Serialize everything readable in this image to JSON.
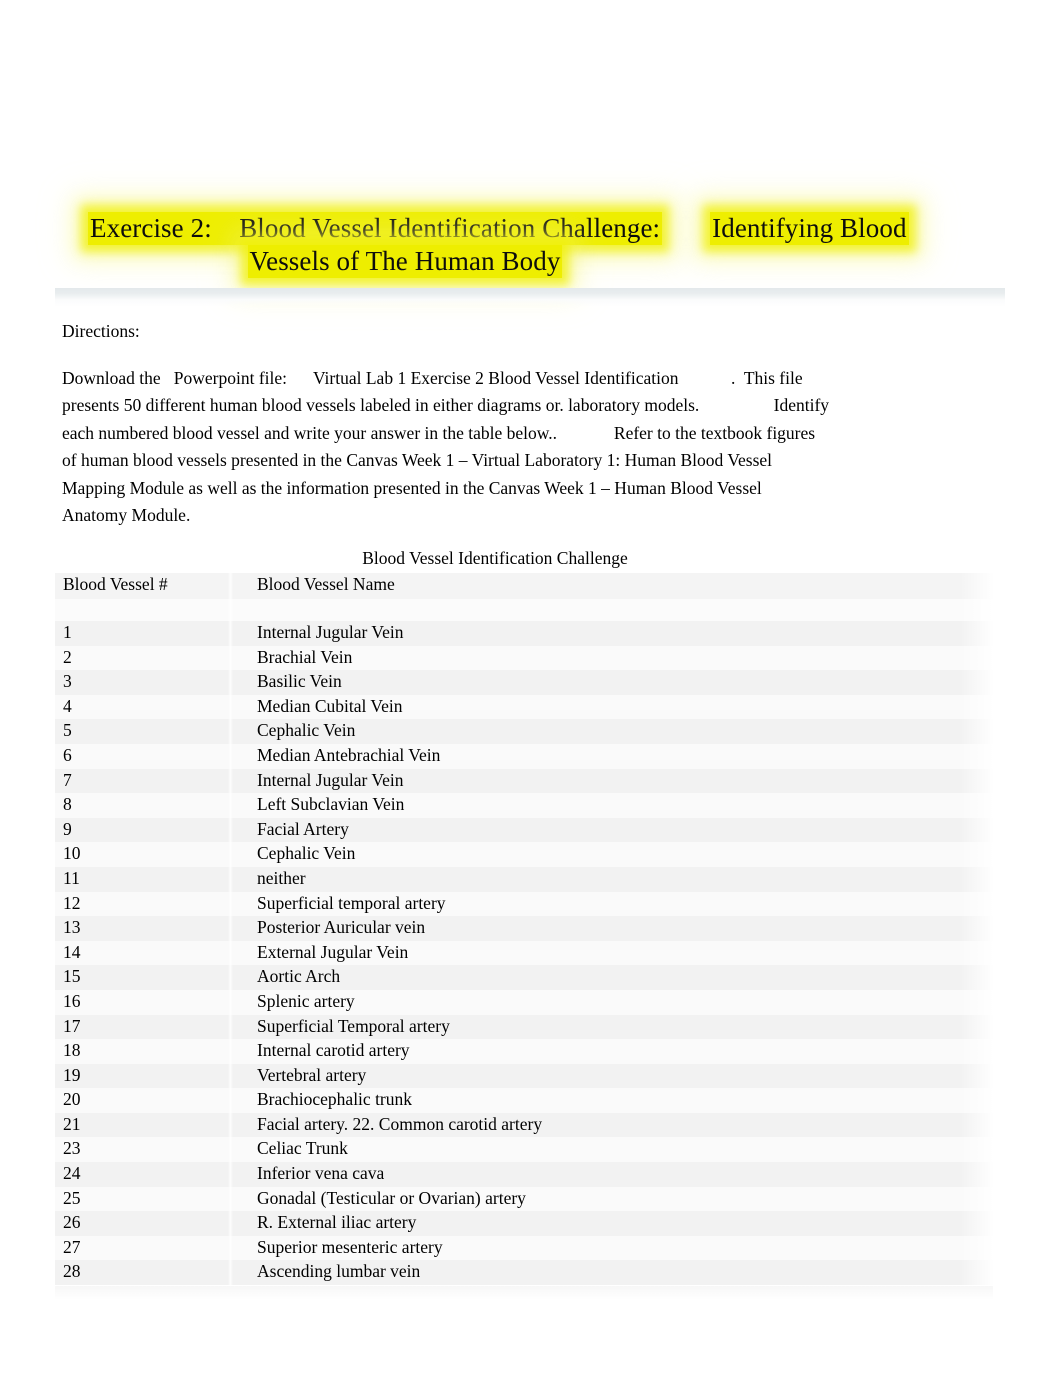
{
  "document": {
    "title_line_1": "Exercise 2:    Blood Vessel Identification Challenge:       Identifying Blood",
    "title_line_1_highlight_a": "Exercise 2:    Blood Vessel Identification Challenge:",
    "title_line_1_highlight_b": "Identifying Blood",
    "title_line_2": "Vessels of The Human Body",
    "highlight_color": "#eeee00",
    "rule_color": "#e8ecee",
    "text_color": "#000000"
  },
  "directions": {
    "label": "Directions:",
    "lines": [
      "Download the   Powerpoint file:      Virtual Lab 1 Exercise 2 Blood Vessel Identification            .  This file",
      "presents 50 different human blood vessels labeled in either diagrams or. laboratory models.                 Identify",
      "each numbered blood vessel and write your answer in the table below..             Refer to the textbook figures",
      "of human blood vessels presented in the Canvas Week 1 – Virtual Laboratory 1: Human Blood Vessel",
      "Mapping Module as well as the information presented in the Canvas Week 1 – Human Blood Vessel",
      "Anatomy Module."
    ]
  },
  "table": {
    "caption": "Blood Vessel Identification Challenge",
    "columns": [
      "Blood Vessel #",
      "Blood Vessel Name"
    ],
    "rows": [
      {
        "number": "1",
        "name": "Internal Jugular Vein"
      },
      {
        "number": "2",
        "name": "Brachial Vein"
      },
      {
        "number": "3",
        "name": "Basilic Vein"
      },
      {
        "number": "4",
        "name": "Median Cubital Vein"
      },
      {
        "number": "5",
        "name": "Cephalic Vein"
      },
      {
        "number": "6",
        "name": "Median Antebrachial Vein"
      },
      {
        "number": "7",
        "name": "Internal Jugular Vein"
      },
      {
        "number": "8",
        "name": "Left Subclavian Vein"
      },
      {
        "number": "9",
        "name": "Facial Artery"
      },
      {
        "number": "10",
        "name": "Cephalic Vein"
      },
      {
        "number": "11",
        "name": "neither"
      },
      {
        "number": "12",
        "name": "Superficial temporal artery"
      },
      {
        "number": "13",
        "name": "Posterior Auricular vein"
      },
      {
        "number": "14",
        "name": "External Jugular Vein"
      },
      {
        "number": "15",
        "name": "Aortic Arch"
      },
      {
        "number": "16",
        "name": "Splenic artery"
      },
      {
        "number": "17",
        "name": "Superficial Temporal artery"
      },
      {
        "number": "18",
        "name": "Internal carotid artery"
      },
      {
        "number": "19",
        "name": "Vertebral artery"
      },
      {
        "number": "20",
        "name": "Brachiocephalic trunk"
      },
      {
        "number": "21",
        "name": "Facial artery. 22. Common carotid artery"
      },
      {
        "number": "23",
        "name": "Celiac Trunk"
      },
      {
        "number": "24",
        "name": "Inferior vena cava"
      },
      {
        "number": "25",
        "name": "Gonadal (Testicular or Ovarian) artery"
      },
      {
        "number": "26",
        "name": "R. External iliac artery"
      },
      {
        "number": "27",
        "name": "Superior mesenteric artery"
      },
      {
        "number": "28",
        "name": "Ascending lumbar vein"
      }
    ]
  }
}
